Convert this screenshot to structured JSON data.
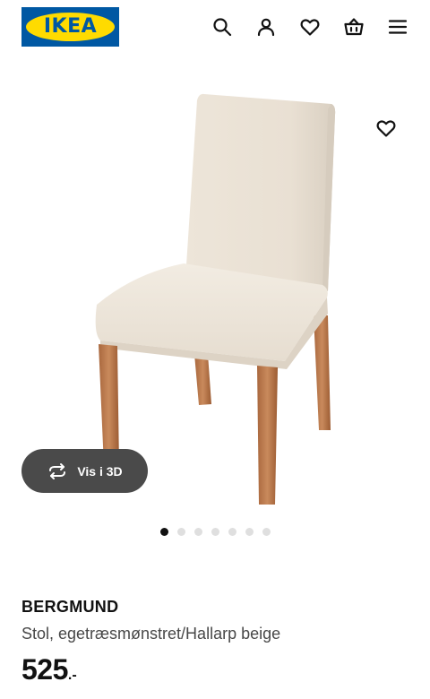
{
  "header": {
    "logo_text": "IKEA",
    "icons": [
      "search-icon",
      "user-icon",
      "heart-icon",
      "basket-icon",
      "menu-icon"
    ]
  },
  "gallery": {
    "view_3d_label": "Vis i 3D",
    "dot_count": 7,
    "active_dot": 0
  },
  "product": {
    "name": "BERGMUND",
    "description": "Stol, egetræsmønstret/Hallarp beige",
    "price_integer": "525",
    "price_suffix": ".-"
  },
  "colors": {
    "brand_blue": "#0058a3",
    "brand_yellow": "#ffdb00",
    "text": "#111111",
    "button_dark": "#4a4a4a"
  }
}
